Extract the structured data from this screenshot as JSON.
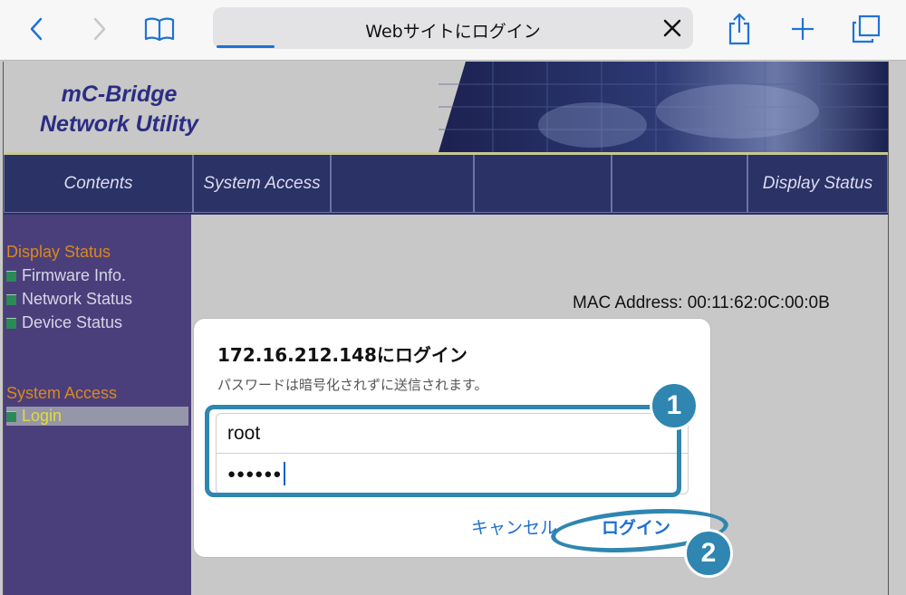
{
  "browser": {
    "page_title": "Webサイトにログイン",
    "icons": [
      "back-icon",
      "forward-icon",
      "bookmarks-icon",
      "close-icon",
      "share-icon",
      "add-tab-icon",
      "tabs-icon"
    ]
  },
  "site": {
    "brand_line1": "mC-Bridge",
    "brand_line2": "Network Utility",
    "nav": [
      "Contents",
      "System Access",
      "",
      "",
      "",
      "Display Status"
    ],
    "sidebar": {
      "display_status_heading": "Display Status",
      "items": [
        "Firmware Info.",
        "Network Status",
        "Device Status"
      ],
      "system_access_heading": "System Access",
      "login_item": "Login"
    },
    "mac_label": "MAC Address: 00:11:62:0C:00:0B"
  },
  "dialog": {
    "title": "172.16.212.148にログイン",
    "subtitle": "パスワードは暗号化されずに送信されます。",
    "username": "root",
    "password_masked": "●●●●●●",
    "cancel_label": "キャンセル",
    "login_label": "ログイン"
  },
  "annotations": {
    "step1": "1",
    "step2": "2",
    "color": "#2f86b0"
  }
}
